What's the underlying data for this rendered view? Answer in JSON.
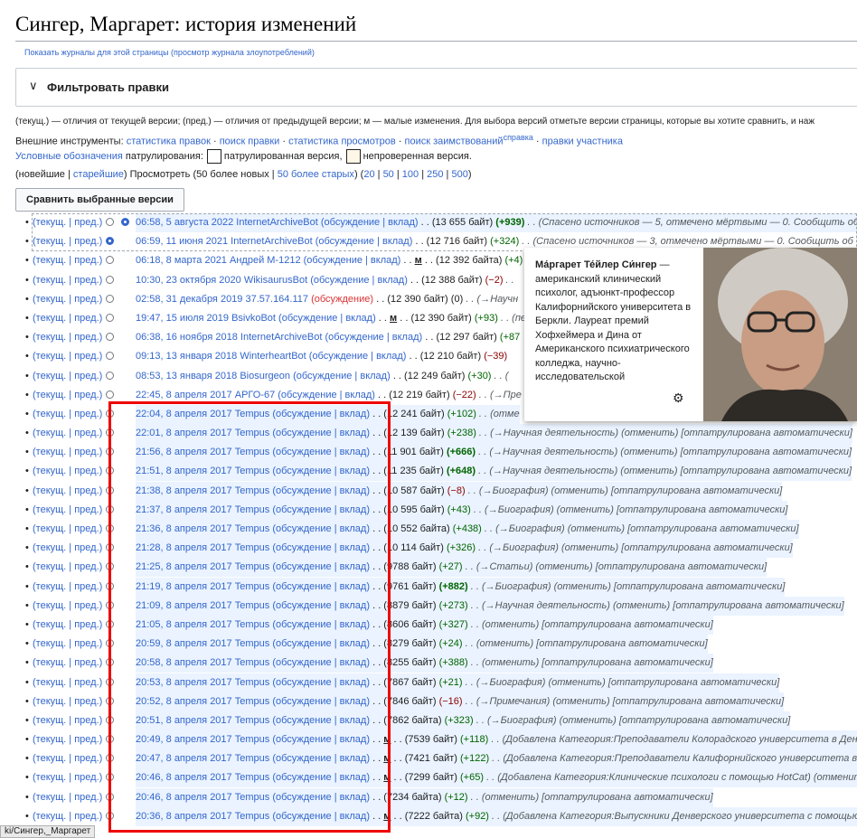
{
  "page_title": "Сингер, Маргарет: история изменений",
  "logs_link": "Показать журналы для этой страницы (просмотр журнала злоупотреблений)",
  "filter": {
    "label": "Фильтровать правки"
  },
  "legend_line": "(текущ.) — отличия от текущей версии; (пред.) — отличия от предыдущей версии; м — малые изменения. Для выбора версий отметьте версии страницы, которые вы хотите сравнить, и наж",
  "tools": {
    "prefix": "Внешние инструменты:",
    "items": [
      "статистика правок",
      "поиск правки",
      "статистика просмотров",
      "поиск заимствований",
      "правки участника"
    ],
    "sup": "справка"
  },
  "patrol_legend": {
    "link": "Условные обозначения",
    "label": "патрулирования:",
    "patrolled": "патрулированная версия,",
    "unpatrolled": "непроверенная версия.",
    "patrolled_color": "#ffffff",
    "unpatrolled_color": "#fef6e7"
  },
  "pager": {
    "open": "(новейшие | ",
    "oldest": "старейшие",
    "mid": ") Просмотреть (50 более новых | ",
    "older": "50 более старых",
    "counts_open": ") (",
    "counts": [
      "20",
      "50",
      "100",
      "250",
      "500"
    ],
    "close": ")"
  },
  "compare_button": "Сравнить выбранные версии",
  "rows": [
    {
      "cur": "(текущ. | пред.)",
      "date": "06:58, 5 августа 2022",
      "user": "InternetArchiveBot",
      "links": "(обсуждение | вклад)",
      "minor": "",
      "size": ". . (13 655 байт)",
      "diff": "(+939)",
      "diffcls": "pos b",
      "rest": ". . (Спасено источников — 5, отмечено мёртвыми — 0. Сообщить об",
      "sel": "b",
      "unpat": true
    },
    {
      "cur": "(текущ. | пред.)",
      "date": "06:59, 11 июня 2021",
      "user": "InternetArchiveBot",
      "links": "(обсуждение | вклад)",
      "minor": "",
      "size": ". . (12 716 байт)",
      "diff": "(+324)",
      "diffcls": "pos",
      "rest": ". . (Спасено источников — 3, отмечено мёртвыми — 0. Сообщить об",
      "sel": "a",
      "unpat": false
    },
    {
      "cur": "(текущ. | пред.)",
      "date": "06:18, 8 марта 2021",
      "user": "Андрей М-1212",
      "links": "(обсуждение | вклад)",
      "minor": "м",
      "size": ". . (12 392 байта)",
      "diff": "(+4)",
      "diffcls": "pos",
      "rest": ". .",
      "sel": "",
      "unpat": false
    },
    {
      "cur": "(текущ. | пред.)",
      "date": "10:30, 23 октября 2020",
      "user": "WikisaurusBot",
      "links": "(обсуждение | вклад)",
      "minor": "",
      "size": ". . (12 388 байт)",
      "diff": "(−2)",
      "diffcls": "neg",
      "rest": ". .",
      "sel": "",
      "unpat": false
    },
    {
      "cur": "(текущ. | пред.)",
      "date": "02:58, 31 декабря 2019",
      "user": "37.57.164.117",
      "links": "(обсуждение)",
      "minor": "",
      "size": ". . (12 390 байт)",
      "diff": "(0)",
      "diffcls": "",
      "rest": ". . (→Научн",
      "sel": "",
      "unpat": false
    },
    {
      "cur": "(текущ. | пред.)",
      "date": "19:47, 15 июля 2019",
      "user": "BsivkoBot",
      "links": "(обсуждение | вклад)",
      "minor": "м",
      "size": ". . (12 390 байт)",
      "diff": "(+93)",
      "diffcls": "pos",
      "rest": ". . (пер",
      "sel": "",
      "unpat": false
    },
    {
      "cur": "(текущ. | пред.)",
      "date": "06:38, 16 ноября 2018",
      "user": "InternetArchiveBot",
      "links": "(обсуждение | вклад)",
      "minor": "",
      "size": ". . (12 297 байт)",
      "diff": "(+87",
      "diffcls": "pos",
      "rest": "",
      "sel": "",
      "unpat": false
    },
    {
      "cur": "(текущ. | пред.)",
      "date": "09:13, 13 января 2018",
      "user": "WinterheartBot",
      "links": "(обсуждение | вклад)",
      "minor": "",
      "size": ". . (12 210 байт)",
      "diff": "(−39)",
      "diffcls": "neg",
      "rest": "",
      "sel": "",
      "unpat": false
    },
    {
      "cur": "(текущ. | пред.)",
      "date": "08:53, 13 января 2018",
      "user": "Biosurgeon",
      "links": "(обсуждение | вклад)",
      "minor": "",
      "size": ". . (12 249 байт)",
      "diff": "(+30)",
      "diffcls": "pos",
      "rest": ". . (",
      "sel": "",
      "unpat": false
    },
    {
      "cur": "(текущ. | пред.)",
      "date": "22:45, 8 апреля 2017",
      "user": "АРГО-67",
      "links": "(обсуждение | вклад)",
      "minor": "",
      "size": ". . (12 219 байт)",
      "diff": "(−22)",
      "diffcls": "neg",
      "rest": ". . (→Пре",
      "sel": "",
      "unpat": false
    },
    {
      "cur": "(текущ. | пред.)",
      "date": "22:04, 8 апреля 2017",
      "user": "Tempus",
      "links": "(обсуждение | вклад)",
      "minor": "",
      "size": ". . (12 241 байт)",
      "diff": "(+102)",
      "diffcls": "pos",
      "rest": ". . (отме",
      "sel": "",
      "unpat": true
    },
    {
      "cur": "(текущ. | пред.)",
      "date": "22:01, 8 апреля 2017",
      "user": "Tempus",
      "links": "(обсуждение | вклад)",
      "minor": "",
      "size": ". . (12 139 байт)",
      "diff": "(+238)",
      "diffcls": "pos",
      "rest": ". . (→Научная деятельность) (отменить) [отпатрулирована автоматически]",
      "sel": "",
      "unpat": true
    },
    {
      "cur": "(текущ. | пред.)",
      "date": "21:56, 8 апреля 2017",
      "user": "Tempus",
      "links": "(обсуждение | вклад)",
      "minor": "",
      "size": ". . (11 901 байт)",
      "diff": "(+666)",
      "diffcls": "pos b",
      "rest": ". . (→Научная деятельность) (отменить) [отпатрулирована автоматически]",
      "sel": "",
      "unpat": true
    },
    {
      "cur": "(текущ. | пред.)",
      "date": "21:51, 8 апреля 2017",
      "user": "Tempus",
      "links": "(обсуждение | вклад)",
      "minor": "",
      "size": ". . (11 235 байт)",
      "diff": "(+648)",
      "diffcls": "pos b",
      "rest": ". . (→Научная деятельность) (отменить) [отпатрулирована автоматически]",
      "sel": "",
      "unpat": true
    },
    {
      "cur": "(текущ. | пред.)",
      "date": "21:38, 8 апреля 2017",
      "user": "Tempus",
      "links": "(обсуждение | вклад)",
      "minor": "",
      "size": ". . (10 587 байт)",
      "diff": "(−8)",
      "diffcls": "neg",
      "rest": ". . (→Биография) (отменить) [отпатрулирована автоматически]",
      "sel": "",
      "unpat": true
    },
    {
      "cur": "(текущ. | пред.)",
      "date": "21:37, 8 апреля 2017",
      "user": "Tempus",
      "links": "(обсуждение | вклад)",
      "minor": "",
      "size": ". . (10 595 байт)",
      "diff": "(+43)",
      "diffcls": "pos",
      "rest": ". . (→Биография) (отменить) [отпатрулирована автоматически]",
      "sel": "",
      "unpat": true
    },
    {
      "cur": "(текущ. | пред.)",
      "date": "21:36, 8 апреля 2017",
      "user": "Tempus",
      "links": "(обсуждение | вклад)",
      "minor": "",
      "size": ". . (10 552 байта)",
      "diff": "(+438)",
      "diffcls": "pos",
      "rest": ". . (→Биография) (отменить) [отпатрулирована автоматически]",
      "sel": "",
      "unpat": true
    },
    {
      "cur": "(текущ. | пред.)",
      "date": "21:28, 8 апреля 2017",
      "user": "Tempus",
      "links": "(обсуждение | вклад)",
      "minor": "",
      "size": ". . (10 114 байт)",
      "diff": "(+326)",
      "diffcls": "pos",
      "rest": ". . (→Биография) (отменить) [отпатрулирована автоматически]",
      "sel": "",
      "unpat": true
    },
    {
      "cur": "(текущ. | пред.)",
      "date": "21:25, 8 апреля 2017",
      "user": "Tempus",
      "links": "(обсуждение | вклад)",
      "minor": "",
      "size": ". . (9788 байт)",
      "diff": "(+27)",
      "diffcls": "pos",
      "rest": ". . (→Статьи) (отменить) [отпатрулирована автоматически]",
      "sel": "",
      "unpat": true
    },
    {
      "cur": "(текущ. | пред.)",
      "date": "21:19, 8 апреля 2017",
      "user": "Tempus",
      "links": "(обсуждение | вклад)",
      "minor": "",
      "size": ". . (9761 байт)",
      "diff": "(+882)",
      "diffcls": "pos b",
      "rest": ". . (→Биография) (отменить) [отпатрулирована автоматически]",
      "sel": "",
      "unpat": true
    },
    {
      "cur": "(текущ. | пред.)",
      "date": "21:09, 8 апреля 2017",
      "user": "Tempus",
      "links": "(обсуждение | вклад)",
      "minor": "",
      "size": ". . (8879 байт)",
      "diff": "(+273)",
      "diffcls": "pos",
      "rest": ". . (→Научная деятельность) (отменить) [отпатрулирована автоматически]",
      "sel": "",
      "unpat": true
    },
    {
      "cur": "(текущ. | пред.)",
      "date": "21:05, 8 апреля 2017",
      "user": "Tempus",
      "links": "(обсуждение | вклад)",
      "minor": "",
      "size": ". . (8606 байт)",
      "diff": "(+327)",
      "diffcls": "pos",
      "rest": ". . (отменить) [отпатрулирована автоматически]",
      "sel": "",
      "unpat": true
    },
    {
      "cur": "(текущ. | пред.)",
      "date": "20:59, 8 апреля 2017",
      "user": "Tempus",
      "links": "(обсуждение | вклад)",
      "minor": "",
      "size": ". . (8279 байт)",
      "diff": "(+24)",
      "diffcls": "pos",
      "rest": ". . (отменить) [отпатрулирована автоматически]",
      "sel": "",
      "unpat": true
    },
    {
      "cur": "(текущ. | пред.)",
      "date": "20:58, 8 апреля 2017",
      "user": "Tempus",
      "links": "(обсуждение | вклад)",
      "minor": "",
      "size": ". . (8255 байт)",
      "diff": "(+388)",
      "diffcls": "pos",
      "rest": ". . (отменить) [отпатрулирована автоматически]",
      "sel": "",
      "unpat": true
    },
    {
      "cur": "(текущ. | пред.)",
      "date": "20:53, 8 апреля 2017",
      "user": "Tempus",
      "links": "(обсуждение | вклад)",
      "minor": "",
      "size": ". . (7867 байт)",
      "diff": "(+21)",
      "diffcls": "pos",
      "rest": ". . (→Биография) (отменить) [отпатрулирована автоматически]",
      "sel": "",
      "unpat": true
    },
    {
      "cur": "(текущ. | пред.)",
      "date": "20:52, 8 апреля 2017",
      "user": "Tempus",
      "links": "(обсуждение | вклад)",
      "minor": "",
      "size": ". . (7846 байт)",
      "diff": "(−16)",
      "diffcls": "neg",
      "rest": ". . (→Примечания) (отменить) [отпатрулирована автоматически]",
      "sel": "",
      "unpat": true
    },
    {
      "cur": "(текущ. | пред.)",
      "date": "20:51, 8 апреля 2017",
      "user": "Tempus",
      "links": "(обсуждение | вклад)",
      "minor": "",
      "size": ". . (7862 байта)",
      "diff": "(+323)",
      "diffcls": "pos",
      "rest": ". . (→Биография) (отменить) [отпатрулирована автоматически]",
      "sel": "",
      "unpat": true
    },
    {
      "cur": "(текущ. | пред.)",
      "date": "20:49, 8 апреля 2017",
      "user": "Tempus",
      "links": "(обсуждение | вклад)",
      "minor": "м",
      "size": ". . (7539 байт)",
      "diff": "(+118)",
      "diffcls": "pos",
      "rest": ". . (Добавлена Категория:Преподаватели Колорадского университета в Денве",
      "sel": "",
      "unpat": true
    },
    {
      "cur": "(текущ. | пред.)",
      "date": "20:47, 8 апреля 2017",
      "user": "Tempus",
      "links": "(обсуждение | вклад)",
      "minor": "м",
      "size": ". . (7421 байт)",
      "diff": "(+122)",
      "diffcls": "pos",
      "rest": ". . (Добавлена Категория:Преподаватели Калифорнийского университета в Б",
      "sel": "",
      "unpat": true
    },
    {
      "cur": "(текущ. | пред.)",
      "date": "20:46, 8 апреля 2017",
      "user": "Tempus",
      "links": "(обсуждение | вклад)",
      "minor": "м",
      "size": ". . (7299 байт)",
      "diff": "(+65)",
      "diffcls": "pos",
      "rest": ". . (Добавлена Категория:Клинические психологи с помощью HotCat) (отменить)",
      "sel": "",
      "unpat": true
    },
    {
      "cur": "(текущ. | пред.)",
      "date": "20:46, 8 апреля 2017",
      "user": "Tempus",
      "links": "(обсуждение | вклад)",
      "minor": "",
      "size": ". . (7234 байта)",
      "diff": "(+12)",
      "diffcls": "pos",
      "rest": ". . (отменить) [отпатрулирована автоматически]",
      "sel": "",
      "unpat": true
    },
    {
      "cur": "(текущ. | пред.)",
      "date": "20:36, 8 апреля 2017",
      "user": "Tempus",
      "links": "(обсуждение | вклад)",
      "minor": "м",
      "size": ". . (7222 байта)",
      "diff": "(+92)",
      "diffcls": "pos",
      "rest": ". . (Добавлена Категория:Выпускники Денверского университета с помощью H",
      "sel": "",
      "unpat": true
    }
  ],
  "popup": {
    "name": "Ма́ргарет Те́йлер Си́нгер",
    "text": "— американский клинический психолог, адъюнкт-профессор Калифорнийского университета в Беркли. Лауреат премий Хофхеймера и Дина от Американского психиатрического колледжа, научно-исследовательской",
    "gear_icon": "gear-icon"
  },
  "status_bar": "ki/Сингер,_Маргарет"
}
